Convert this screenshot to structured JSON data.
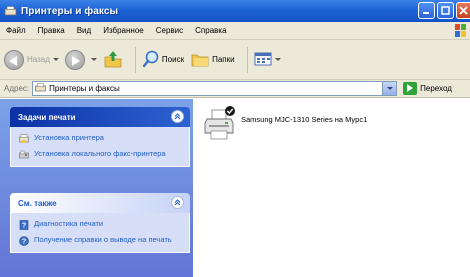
{
  "window": {
    "title": "Принтеры и факсы",
    "colors": {
      "titlebar": "#1d63d6",
      "task_pane": "#6f8fe0",
      "link": "#215dc6"
    }
  },
  "menubar": {
    "items": [
      "Файл",
      "Правка",
      "Вид",
      "Избранное",
      "Сервис",
      "Справка"
    ]
  },
  "toolbar": {
    "back_label": "Назад",
    "search_label": "Поиск",
    "folders_label": "Папки"
  },
  "address": {
    "label": "Адрес:",
    "value": "Принтеры и факсы",
    "go_label": "Переход"
  },
  "taskpane": {
    "print_tasks": {
      "title": "Задачи печати",
      "items": [
        {
          "label": "Установка принтера",
          "icon": "add-printer-icon"
        },
        {
          "label": "Установка локального факс-принтера",
          "icon": "fax-icon"
        }
      ]
    },
    "see_also": {
      "title": "См. также",
      "items": [
        {
          "label": "Диагностика печати",
          "icon": "help-book-icon"
        },
        {
          "label": "Получение справки о выводе на печать",
          "icon": "help-globe-icon"
        }
      ]
    }
  },
  "main": {
    "printers": [
      {
        "name": "Samsung MJC-1310 Series на Mypc1",
        "default": true,
        "icon": "printer-icon"
      }
    ]
  }
}
